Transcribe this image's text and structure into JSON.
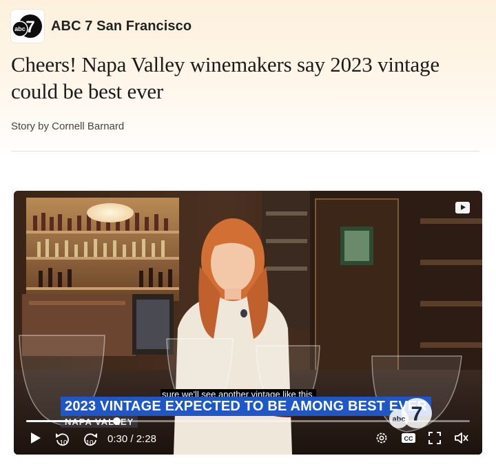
{
  "publisher": {
    "name": "ABC 7 San Francisco",
    "logo_text": "abc",
    "logo_number": "7"
  },
  "article": {
    "headline": "Cheers! Napa Valley winemakers say 2023 vintage could be best ever",
    "byline": "Story by Cornell Barnard"
  },
  "video": {
    "caption": "sure we'll see another vintage like this.",
    "lower_third": "2023 VINTAGE EXPECTED TO BE AMONG BEST EVER",
    "location_tag": "NAPA VALLEY",
    "watermark_text": "abc",
    "watermark_number": "7",
    "current_time": "0:30",
    "time_separator": "/",
    "duration": "2:28",
    "progress_fraction": 0.2027,
    "rewind_seconds": "10",
    "forward_seconds": "10",
    "icons": {
      "source": "video-play-badge-icon",
      "play": "play-icon",
      "rewind": "rewind-10-icon",
      "forward": "forward-10-icon",
      "settings": "gear-icon",
      "captions": "closed-captions-icon",
      "fullscreen": "fullscreen-icon",
      "mute": "mute-icon"
    },
    "colors": {
      "lower_third_bg": "#1d57c8",
      "caption_bg": "#000000"
    }
  }
}
